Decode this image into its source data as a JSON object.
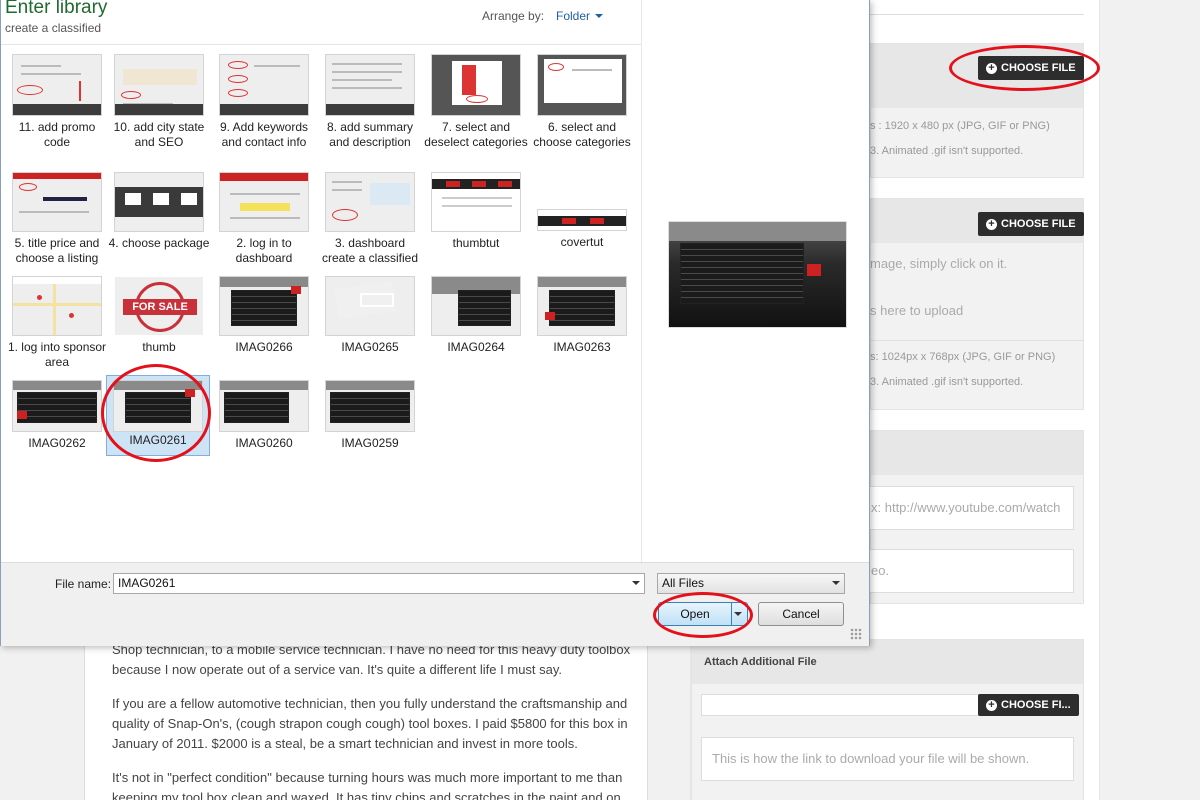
{
  "dialog": {
    "title": "Enter library",
    "subtitle": "create a classified",
    "arrange_label": "Arrange by:",
    "arrange_value": "Folder",
    "tiles": [
      {
        "label": "11. add promo code"
      },
      {
        "label": "10. add city state and SEO"
      },
      {
        "label": "9. Add keywords and contact info"
      },
      {
        "label": "8. add summary and description"
      },
      {
        "label": "7. select and deselect categories"
      },
      {
        "label": "6. select and choose categories"
      },
      {
        "label": "5. title price and choose a listing"
      },
      {
        "label": "4. choose package"
      },
      {
        "label": "2. log in to dashboard"
      },
      {
        "label": "3. dashboard create a classified"
      },
      {
        "label": "thumbtut"
      },
      {
        "label": "covertut"
      },
      {
        "label": "1. log into sponsor area"
      },
      {
        "label": "thumb"
      },
      {
        "label": "IMAG0266"
      },
      {
        "label": "IMAG0265"
      },
      {
        "label": "IMAG0264"
      },
      {
        "label": "IMAG0263"
      },
      {
        "label": "IMAG0262"
      },
      {
        "label": "IMAG0261",
        "selected": true
      },
      {
        "label": "IMAG0260"
      },
      {
        "label": "IMAG0259"
      }
    ],
    "stamp_text": "FOR SALE",
    "file_name_label": "File name:",
    "file_name_value": "IMAG0261",
    "file_type_value": "All Files",
    "open_label": "Open",
    "cancel_label": "Cancel"
  },
  "page": {
    "choose_file_label": "CHOOSE FILE",
    "choose_file_short": "CHOOSE FI...",
    "hint_cover_size": "s : 1920 x 480 px (JPG, GIF or PNG)",
    "hint_animated_1": "3. Animated .gif isn't supported.",
    "hint_click": "mage, simply click on it.",
    "hint_upload": "s here to upload",
    "hint_img_size": "s: 1024px x 768px (JPG, GIF or PNG)",
    "hint_animated_2": "3. Animated .gif isn't supported.",
    "video_placeholder": "x: http://www.youtube.com/watch",
    "video_hint": "eo.",
    "attach_title": "Attach Additional File",
    "download_placeholder": "This is how the link to download your file will be shown.",
    "article": [
      "Shop technician, to a mobile service technician. I have no need for this heavy duty toolbox because I now operate out of a service van. It's quite a different life I must say.",
      "If you are a fellow automotive technician, then you fully understand the craftsmanship and quality of Snap-On's, (cough strapon cough cough) tool boxes. I paid $5800 for this box in January of 2011. $2000 is a steal, be a smart technician and invest in more tools.",
      "It's not in \"perfect condition\" because turning hours was much more important to me than keeping my tool box clean and waxed. It has tiny chips and scratches in the paint and on the"
    ]
  },
  "colors": {
    "annotation": "#e4111b",
    "title_green": "#1e6a2f",
    "link_blue": "#1f5fa8",
    "selection": "#cde4f7"
  }
}
